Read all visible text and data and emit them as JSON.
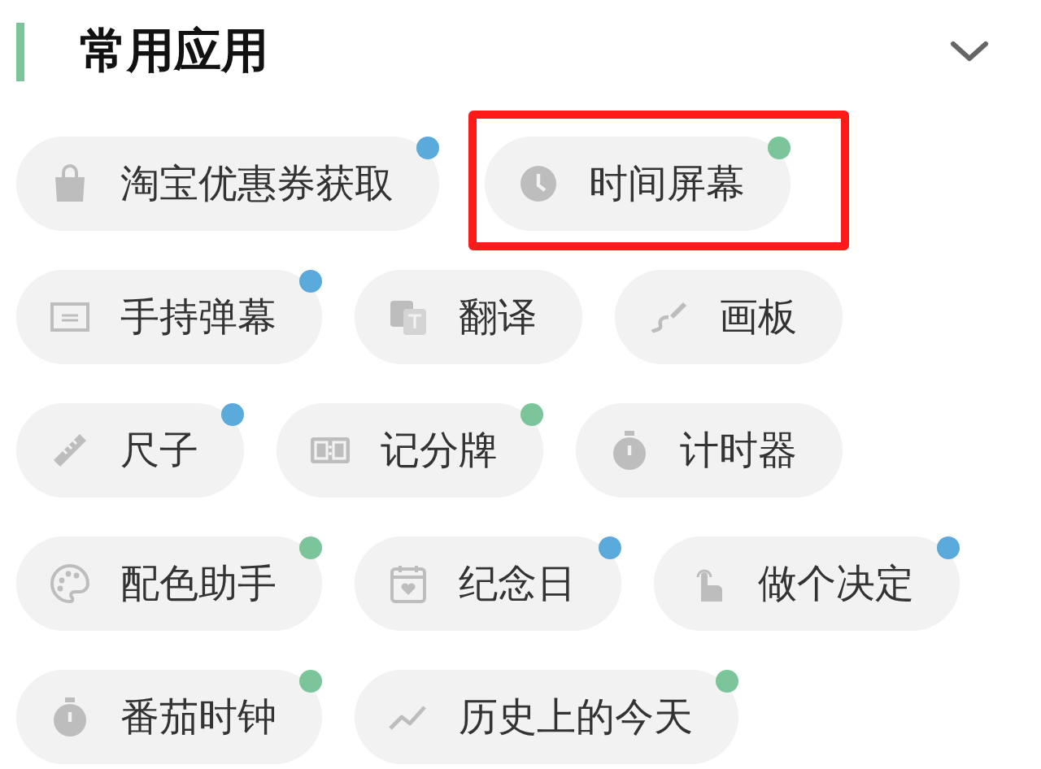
{
  "section": {
    "title": "常用应用",
    "expanded": true
  },
  "rows": [
    {
      "items": [
        {
          "label": "淘宝优惠券获取",
          "color": "#5aabdc",
          "highlighted": false
        },
        {
          "label": "时间屏幕",
          "color": "#7cc49a",
          "highlighted": true
        }
      ]
    },
    {
      "items": [
        {
          "label": "手持弹幕",
          "color": "#5aabdc",
          "highlighted": false
        },
        {
          "label": "翻译",
          "highlighted": false
        },
        {
          "label": "画板",
          "highlighted": false
        }
      ]
    },
    {
      "items": [
        {
          "label": "尺子",
          "color": "#5aabdc",
          "highlighted": false
        },
        {
          "label": "记分牌",
          "color": "#7cc49a",
          "highlighted": false
        },
        {
          "label": "计时器",
          "highlighted": false
        }
      ]
    },
    {
      "items": [
        {
          "label": "配色助手",
          "color": "#7cc49a",
          "highlighted": false
        },
        {
          "label": "纪念日",
          "color": "#5aabdc",
          "highlighted": false
        },
        {
          "label": "做个决定",
          "color": "#5aabdc",
          "highlighted": false
        }
      ]
    },
    {
      "items": [
        {
          "label": "番茄时钟",
          "color": "#7cc49a",
          "highlighted": false
        },
        {
          "label": "历史上的今天",
          "color": "#7cc49a",
          "highlighted": false
        }
      ]
    }
  ]
}
